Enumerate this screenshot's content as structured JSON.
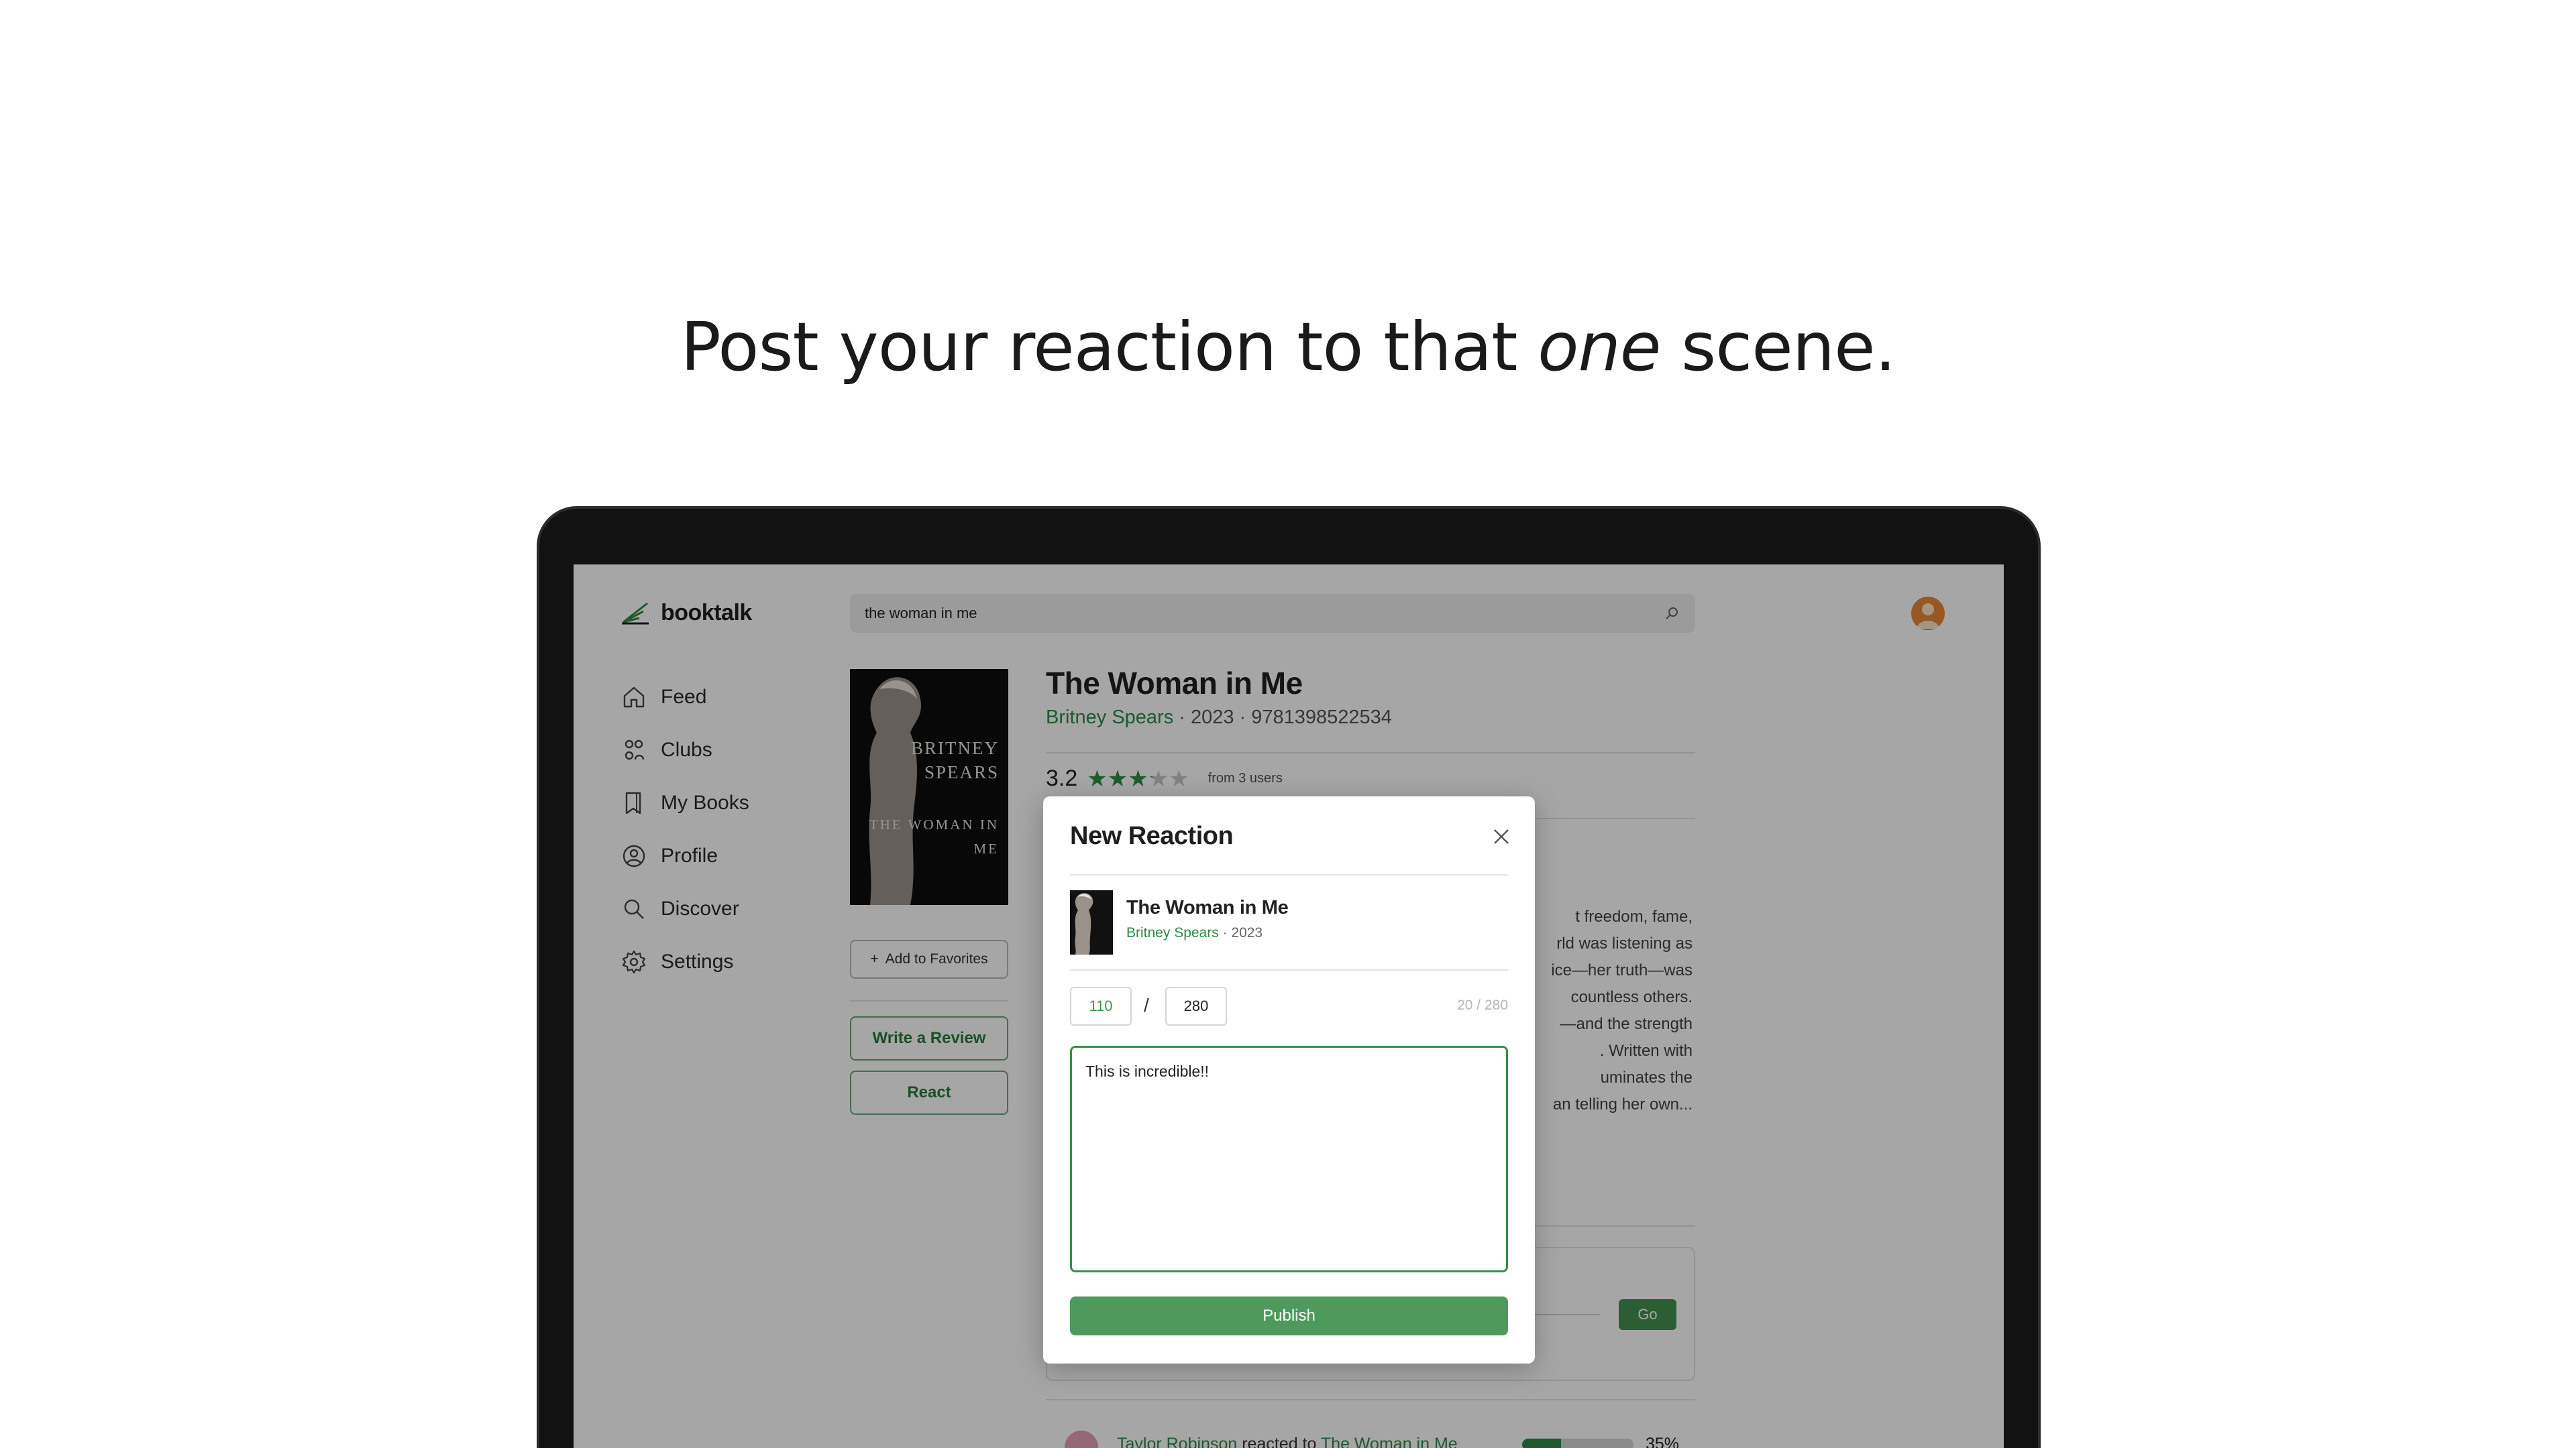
{
  "headline": {
    "before": "Post your reaction to that ",
    "emphasis": "one",
    "after": " scene."
  },
  "app": {
    "brand": "booktalk",
    "search": {
      "value": "the woman in me"
    },
    "nav": [
      {
        "label": "Feed",
        "icon": "home-icon"
      },
      {
        "label": "Clubs",
        "icon": "clubs-icon"
      },
      {
        "label": "My Books",
        "icon": "bookmark-book-icon"
      },
      {
        "label": "Profile",
        "icon": "profile-icon"
      },
      {
        "label": "Discover",
        "icon": "search-icon"
      },
      {
        "label": "Settings",
        "icon": "gear-icon"
      }
    ]
  },
  "book": {
    "title": "The Woman in Me",
    "author": "Britney Spears",
    "year": "2023",
    "isbn": "9781398522534",
    "meta_rest": " · 2023 · 9781398522534",
    "rating": "3.2",
    "rating_value": 3.2,
    "rating_max": 5,
    "rating_count": "from 3 users",
    "cover_author": "BRITNEY SPEARS",
    "cover_title": "THE WOMAN IN ME",
    "description_lines": [
      "t freedom, fame,",
      "rld was listening as",
      "ice—her truth—was",
      "countless others.",
      "—and the strength",
      ". Written with",
      "uminates the",
      "an telling her own..."
    ]
  },
  "sidebar_actions": {
    "favorites": "Add to Favorites",
    "review": "Write a Review",
    "react": "React"
  },
  "progress_card": {
    "go": "Go"
  },
  "activity": {
    "user": "Taylor Robinson",
    "verb": " reacted to ",
    "book": "The Woman in Me",
    "progress": 0.35,
    "progress_label": "35%"
  },
  "modal": {
    "title": "New Reaction",
    "book_title": "The Woman in Me",
    "book_author": "Britney Spears",
    "book_year": " · 2023",
    "page_current": "110",
    "page_separator": "/",
    "page_total": "280",
    "char_count": "20 / 280",
    "text": "This is incredible!!",
    "publish": "Publish"
  },
  "colors": {
    "accent": "#43934f",
    "link_green": "#2d8a44",
    "star": "#2f8f47",
    "star_empty": "#c8c8c8"
  }
}
